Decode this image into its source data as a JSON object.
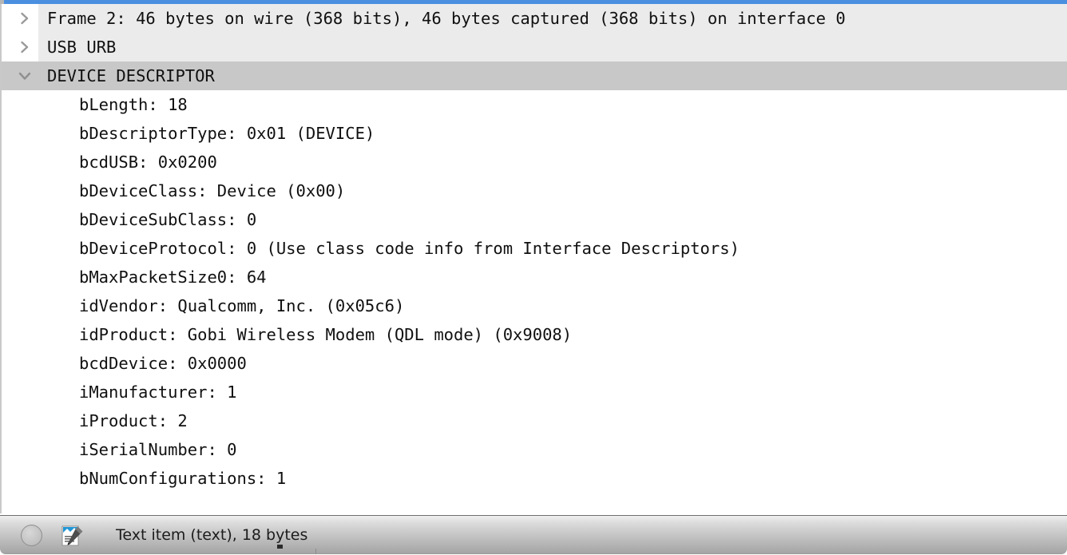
{
  "window": {
    "accent_color": "#4a8fe0"
  },
  "packet_details": {
    "rows": [
      {
        "id": "frame",
        "level": 0,
        "expanded": false,
        "selected": false,
        "twisty": "chevron-right-icon",
        "label": "Frame 2: 46 bytes on wire (368 bits), 46 bytes captured (368 bits) on interface 0"
      },
      {
        "id": "usb-urb",
        "level": 0,
        "expanded": false,
        "selected": false,
        "twisty": "chevron-right-icon",
        "label": "USB URB"
      },
      {
        "id": "device-descriptor",
        "level": 0,
        "expanded": true,
        "selected": true,
        "twisty": "chevron-down-icon",
        "label": "DEVICE DESCRIPTOR"
      },
      {
        "id": "blength",
        "level": 1,
        "label": "bLength: 18"
      },
      {
        "id": "bdescriptortype",
        "level": 1,
        "label": "bDescriptorType: 0x01 (DEVICE)"
      },
      {
        "id": "bcdusb",
        "level": 1,
        "label": "bcdUSB: 0x0200"
      },
      {
        "id": "bdeviceclass",
        "level": 1,
        "label": "bDeviceClass: Device (0x00)"
      },
      {
        "id": "bdevicesubclass",
        "level": 1,
        "label": "bDeviceSubClass: 0"
      },
      {
        "id": "bdeviceprotocol",
        "level": 1,
        "label": "bDeviceProtocol: 0 (Use class code info from Interface Descriptors)"
      },
      {
        "id": "bmaxpacketsize0",
        "level": 1,
        "label": "bMaxPacketSize0: 64"
      },
      {
        "id": "idvendor",
        "level": 1,
        "label": "idVendor: Qualcomm, Inc. (0x05c6)"
      },
      {
        "id": "idproduct",
        "level": 1,
        "label": "idProduct: Gobi Wireless Modem (QDL mode) (0x9008)"
      },
      {
        "id": "bcddevice",
        "level": 1,
        "label": "bcdDevice: 0x0000"
      },
      {
        "id": "imanufacturer",
        "level": 1,
        "label": "iManufacturer: 1"
      },
      {
        "id": "iproduct",
        "level": 1,
        "label": "iProduct: 2"
      },
      {
        "id": "iserialnumber",
        "level": 1,
        "label": "iSerialNumber: 0"
      },
      {
        "id": "bnumconfigurations",
        "level": 1,
        "label": "bNumConfigurations: 1"
      }
    ]
  },
  "status_bar": {
    "expert_info_icon": "expert-info-circle-icon",
    "comment_icon": "capture-comment-icon",
    "text": "Text item (text), 18 bytes"
  }
}
